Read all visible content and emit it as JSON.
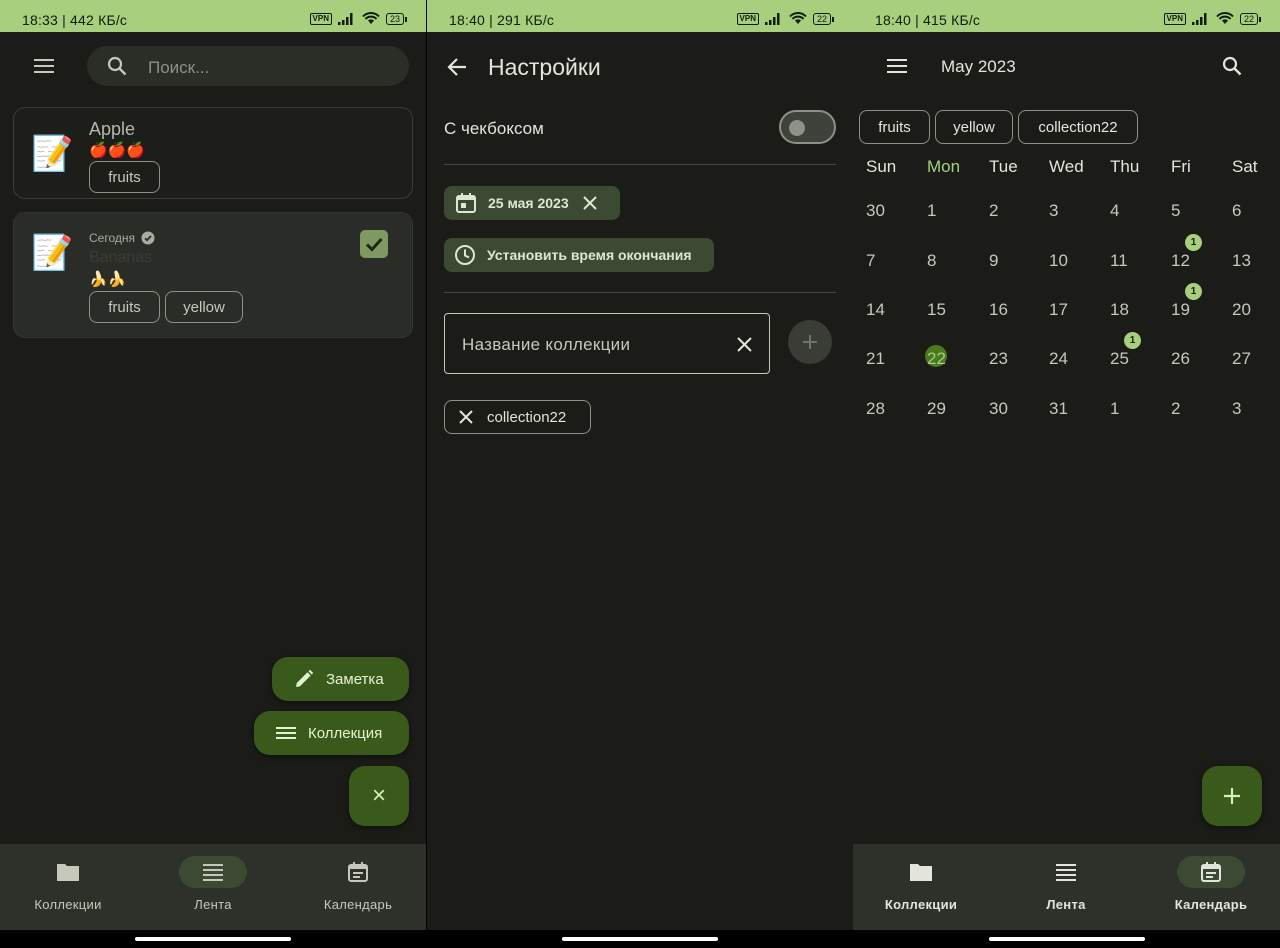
{
  "colors": {
    "accent": "#a7cf7e",
    "fab": "#3a5a1b",
    "background": "#1b1c18",
    "nav_background": "#2d3129"
  },
  "screen1": {
    "status": {
      "time": "18:33 | 442 КБ/с",
      "vpn": "VPN",
      "battery": "23"
    },
    "search_placeholder": "Поиск...",
    "notes": [
      {
        "title": "Apple",
        "emoji": "🍎🍎🍎",
        "tags": [
          "fruits"
        ]
      },
      {
        "date_label": "Сегодня",
        "title": "Bananas",
        "emoji": "🍌🍌",
        "tags": [
          "fruits",
          "yellow"
        ],
        "checked": true
      }
    ],
    "fab_note": "Заметка",
    "fab_collection": "Коллекция",
    "fab_close": "×",
    "nav": [
      "Коллекции",
      "Лента",
      "Календарь"
    ],
    "nav_active": "Лента"
  },
  "screen2": {
    "status": {
      "time": "18:40 | 291 КБ/с",
      "vpn": "VPN",
      "battery": "22"
    },
    "title": "Настройки",
    "checkbox_label": "С чекбоксом",
    "date_chip": "25 мая 2023",
    "end_time_chip": "Установить время окончания",
    "collection_placeholder": "Название коллекции",
    "collection_chip": "collection22"
  },
  "screen3": {
    "status": {
      "time": "18:40 | 415 КБ/с",
      "vpn": "VPN",
      "battery": "22"
    },
    "month_title": "May 2023",
    "filter_chips": [
      "fruits",
      "yellow",
      "collection22"
    ],
    "weekdays": [
      "Sun",
      "Mon",
      "Tue",
      "Wed",
      "Thu",
      "Fri",
      "Sat"
    ],
    "weeks": [
      [
        "30",
        "1",
        "2",
        "3",
        "4",
        "5",
        "6"
      ],
      [
        "7",
        "8",
        "9",
        "10",
        "11",
        "12",
        "13"
      ],
      [
        "14",
        "15",
        "16",
        "17",
        "18",
        "19",
        "20"
      ],
      [
        "21",
        "22",
        "23",
        "24",
        "25",
        "26",
        "27"
      ],
      [
        "28",
        "29",
        "30",
        "31",
        "1",
        "2",
        "3"
      ]
    ],
    "today": "22",
    "badges": {
      "12": "1",
      "19": "1",
      "25": "1"
    },
    "nav": [
      "Коллекции",
      "Лента",
      "Календарь"
    ],
    "nav_active": "Календарь"
  }
}
